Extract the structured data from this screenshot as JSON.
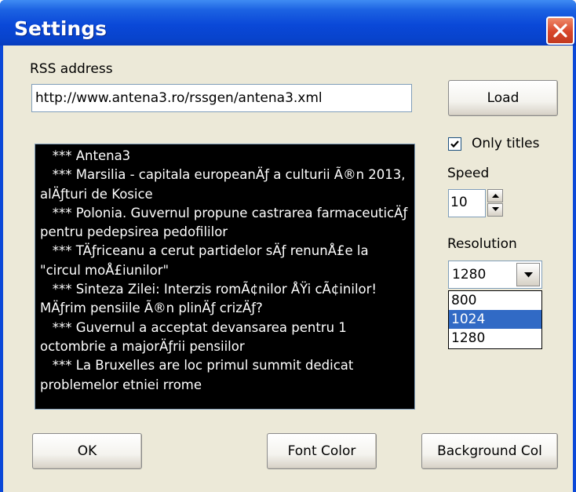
{
  "window": {
    "title": "Settings"
  },
  "rss": {
    "label": "RSS address",
    "value": "http://www.antena3.ro/rssgen/antena3.xml",
    "load_label": "Load"
  },
  "news": {
    "lines": [
      "   *** Antena3",
      "   *** Marsilia - capitala europeanÄƒ a culturii Ã®n 2013, alÄƒturi de Kosice",
      "   *** Polonia. Guvernul propune castrarea farmaceuticÄƒ pentru pedepsirea pedofililor",
      "   *** TÄƒriceanu a cerut partidelor sÄƒ renunÅ£e la \"circul moÅ£iunilor\"",
      "   *** Sinteza Zilei: Interzis romÃ¢nilor ÅŸi cÃ¢inilor! MÄƒrim pensiile Ã®n plinÄƒ crizÄƒ?",
      "   *** Guvernul a acceptat devansarea pentru 1 octombrie a majorÄƒrii pensiilor",
      "   *** La Bruxelles are loc primul summit dedicat problemelor etniei rrome"
    ]
  },
  "options": {
    "only_titles_label": "Only titles",
    "only_titles_checked": true,
    "speed_label": "Speed",
    "speed_value": "10",
    "resolution_label": "Resolution",
    "resolution_value": "1280",
    "resolution_options": [
      "800",
      "1024",
      "1280"
    ],
    "resolution_highlighted": "1024"
  },
  "buttons": {
    "ok_label": "OK",
    "font_color_label": "Font Color",
    "background_label": "Background Col"
  },
  "colors": {
    "titlebar": "#0A48D8",
    "face": "#ECE9D8",
    "close": "#D8452A",
    "highlight": "#316AC5",
    "news_bg": "#000000",
    "news_fg": "#FFFFFF"
  },
  "icons": {
    "close": "close-icon",
    "check": "checkmark-icon",
    "spin_up": "arrow-up-icon",
    "spin_down": "arrow-down-icon",
    "dropdown": "chevron-down-icon"
  }
}
